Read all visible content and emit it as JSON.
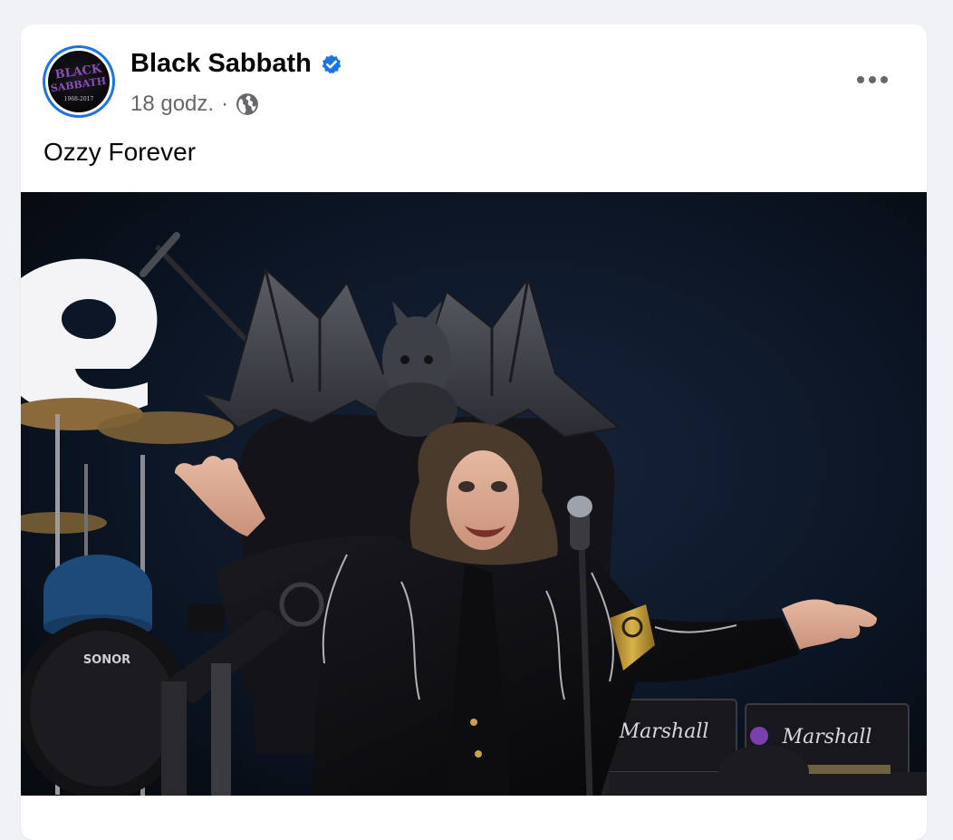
{
  "post": {
    "author": "Black Sabbath",
    "verified": true,
    "time": "18 godz.",
    "separator": "·",
    "audience_icon": "globe-icon",
    "text": "Ozzy Forever",
    "avatar": {
      "logo_text_line1": "BLACK",
      "logo_text_line2": "SABBATH",
      "years": "1968-2017"
    },
    "photo": {
      "amp_brand_1": "Marshall",
      "amp_brand_2": "Marshall",
      "drum_brand": "SONOR"
    }
  },
  "colors": {
    "accent": "#1b74e4",
    "background": "#f0f2f5",
    "secondary_text": "#65676b",
    "logo_purple": "#8a4fb8"
  }
}
